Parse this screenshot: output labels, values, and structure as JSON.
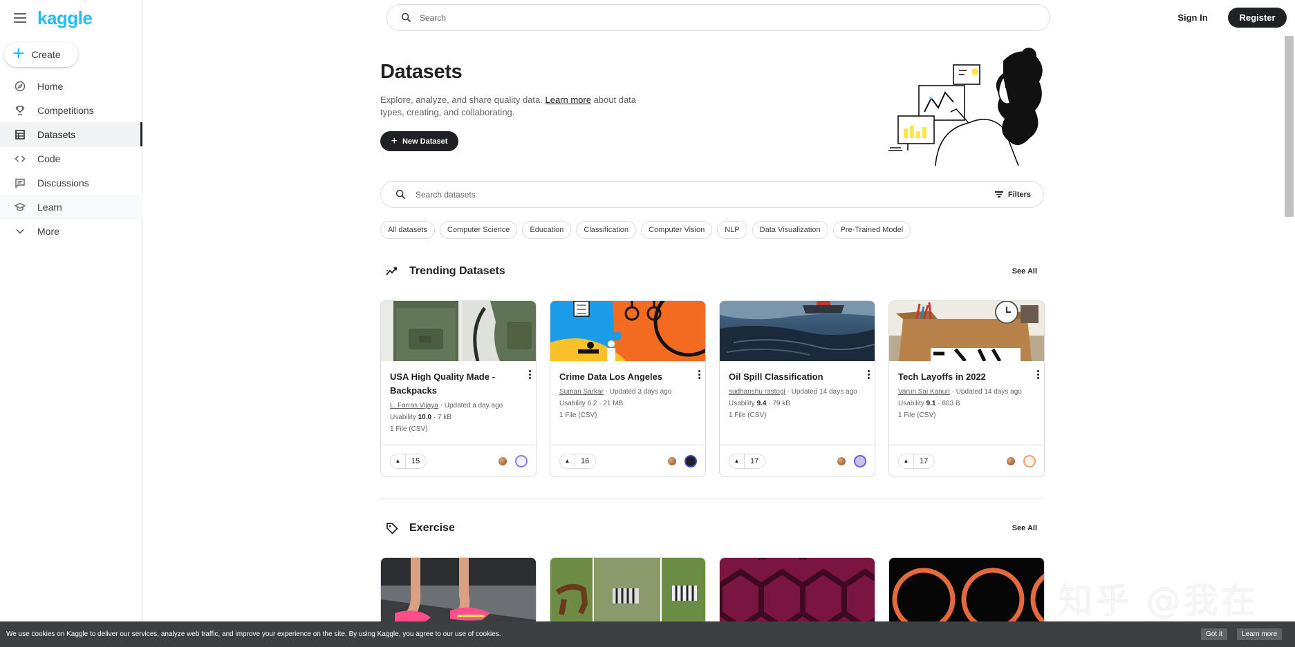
{
  "brand": {
    "logo_text": "kaggle",
    "accent": "#20beff"
  },
  "sidebar": {
    "create_label": "Create",
    "items": [
      {
        "label": "Home",
        "icon": "compass-icon"
      },
      {
        "label": "Competitions",
        "icon": "trophy-icon"
      },
      {
        "label": "Datasets",
        "icon": "table-icon"
      },
      {
        "label": "Code",
        "icon": "code-icon"
      },
      {
        "label": "Discussions",
        "icon": "comment-icon"
      },
      {
        "label": "Learn",
        "icon": "graduation-cap-icon"
      },
      {
        "label": "More",
        "icon": "chevron-down-icon"
      }
    ],
    "active": "Datasets"
  },
  "topbar": {
    "search_placeholder": "Search",
    "signin_label": "Sign In",
    "register_label": "Register"
  },
  "hero": {
    "title": "Datasets",
    "intro_before": "Explore, analyze, and share quality data. ",
    "intro_link": "Learn more",
    "intro_after": " about data types, creating, and collaborating.",
    "new_dataset_label": "New Dataset"
  },
  "dataset_search": {
    "placeholder": "Search datasets",
    "filters_label": "Filters"
  },
  "chips": [
    "All datasets",
    "Computer Science",
    "Education",
    "Classification",
    "Computer Vision",
    "NLP",
    "Data Visualization",
    "Pre-Trained Model"
  ],
  "trending": {
    "title": "Trending Datasets",
    "see_all": "See All",
    "cards": [
      {
        "title": "USA High Quality Made - Backpacks",
        "author": "L. Farras Vijaya",
        "updated": " · Updated a day ago",
        "usability_label": "Usability ",
        "usability": "10.0",
        "size": " · 7 kB",
        "files": "1 File (CSV)",
        "votes": "15"
      },
      {
        "title": "Crime Data Los Angeles",
        "author": "Suman Sarkar",
        "updated": " · Updated 3 days ago",
        "usability_label": "Usability ",
        "usability": "6.2",
        "size": " · 21 MB",
        "files": "1 File (CSV)",
        "votes": "16"
      },
      {
        "title": "Oil Spill Classification",
        "author": "sudhanshu rastogi",
        "updated": " · Updated 14 days ago",
        "usability_label": "Usability ",
        "usability": "9.4",
        "size": " · 79 kB",
        "files": "1 File (CSV)",
        "votes": "17"
      },
      {
        "title": "Tech Layoffs in 2022",
        "author": "Varun Sai Kanuri",
        "updated": " · Updated 14 days ago",
        "usability_label": "Usability ",
        "usability": "9.1",
        "size": " · 803 B",
        "files": "1 File (CSV)",
        "votes": "17"
      }
    ]
  },
  "exercise": {
    "title": "Exercise",
    "see_all": "See All"
  },
  "watermark": "知乎 @我在",
  "cookie": {
    "text": "We use cookies on Kaggle to deliver our services, analyze web traffic, and improve your experience on the site. By using Kaggle, you agree to our use of cookies.",
    "got_it": "Got it",
    "learn_more": "Learn more"
  }
}
